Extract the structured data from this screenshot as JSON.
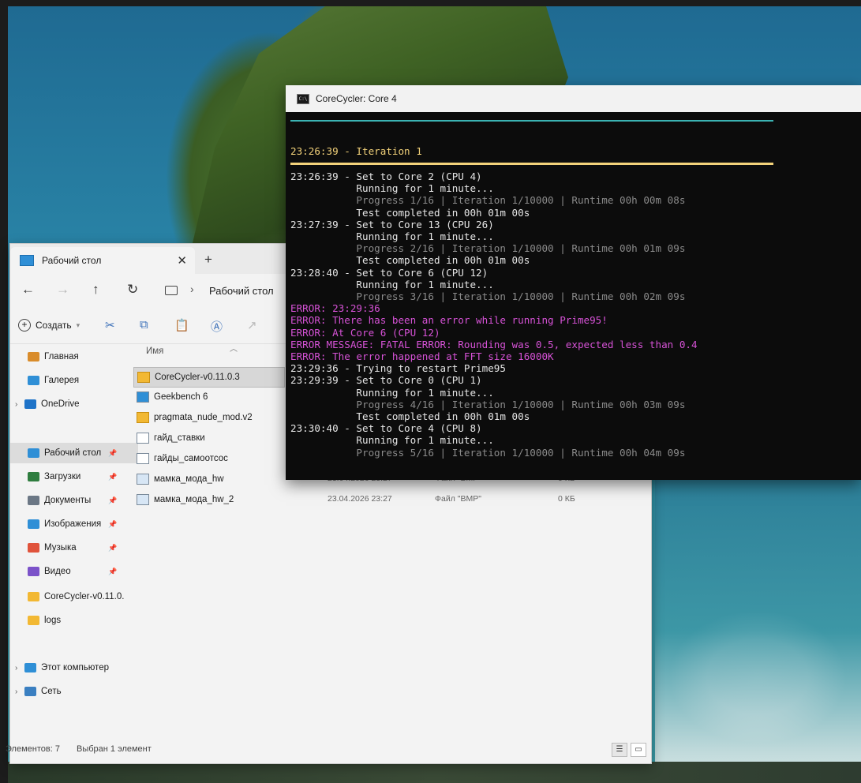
{
  "console": {
    "title": "CoreCycler: Core 4",
    "icon_glyph": "C:\\",
    "iteration_header": "23:26:39 - Iteration 1",
    "lines": [
      {
        "text": "23:26:39 - Set to Core 2 (CPU 4)",
        "style": "normal"
      },
      {
        "text": "           Running for 1 minute...",
        "style": "normal"
      },
      {
        "text": "           Progress 1/16 | Iteration 1/10000 | Runtime 00h 00m 08s",
        "style": "grey"
      },
      {
        "text": "           Test completed in 00h 01m 00s",
        "style": "normal"
      },
      {
        "text": "23:27:39 - Set to Core 13 (CPU 26)",
        "style": "normal"
      },
      {
        "text": "           Running for 1 minute...",
        "style": "normal"
      },
      {
        "text": "           Progress 2/16 | Iteration 1/10000 | Runtime 00h 01m 09s",
        "style": "grey"
      },
      {
        "text": "           Test completed in 00h 01m 00s",
        "style": "normal"
      },
      {
        "text": "23:28:40 - Set to Core 6 (CPU 12)",
        "style": "normal"
      },
      {
        "text": "           Running for 1 minute...",
        "style": "normal"
      },
      {
        "text": "           Progress 3/16 | Iteration 1/10000 | Runtime 00h 02m 09s",
        "style": "grey"
      },
      {
        "text": "ERROR: 23:29:36",
        "style": "magenta"
      },
      {
        "text": "ERROR: There has been an error while running Prime95!",
        "style": "magenta"
      },
      {
        "text": "ERROR: At Core 6 (CPU 12)",
        "style": "magenta"
      },
      {
        "text": "ERROR MESSAGE: FATAL ERROR: Rounding was 0.5, expected less than 0.4",
        "style": "magenta"
      },
      {
        "text": "ERROR: The error happened at FFT size 16000K",
        "style": "magenta"
      },
      {
        "text": "23:29:36 - Trying to restart Prime95",
        "style": "normal"
      },
      {
        "text": "23:29:39 - Set to Core 0 (CPU 1)",
        "style": "normal"
      },
      {
        "text": "           Running for 1 minute...",
        "style": "normal"
      },
      {
        "text": "           Progress 4/16 | Iteration 1/10000 | Runtime 00h 03m 09s",
        "style": "grey"
      },
      {
        "text": "           Test completed in 00h 01m 00s",
        "style": "normal"
      },
      {
        "text": "23:30:40 - Set to Core 4 (CPU 8)",
        "style": "normal"
      },
      {
        "text": "           Running for 1 minute...",
        "style": "normal"
      },
      {
        "text": "           Progress 5/16 | Iteration 1/10000 | Runtime 00h 04m 09s",
        "style": "grey"
      }
    ],
    "colors": {
      "header_rule": "#f3d27a",
      "top_rule": "#3bb3b3",
      "error": "#d652d6",
      "progress": "#8a8a8a"
    }
  },
  "explorer": {
    "tab_title": "Рабочий стол",
    "new_tab": "+",
    "close": "✕",
    "address": "Рабочий стол",
    "create_label": "Создать",
    "column_name": "Имя",
    "sidebar": [
      {
        "label": "Главная",
        "icon": "home-icon",
        "pinned": false
      },
      {
        "label": "Галерея",
        "icon": "gallery-icon",
        "pinned": false
      },
      {
        "label": "OneDrive",
        "icon": "cloud-icon",
        "pinned": false
      },
      {
        "label": "Рабочий стол",
        "icon": "desktop-icon",
        "pinned": true
      },
      {
        "label": "Загрузки",
        "icon": "download-icon",
        "pinned": true
      },
      {
        "label": "Документы",
        "icon": "documents-icon",
        "pinned": true
      },
      {
        "label": "Изображения",
        "icon": "images-icon",
        "pinned": true
      },
      {
        "label": "Музыка",
        "icon": "music-icon",
        "pinned": true
      },
      {
        "label": "Видео",
        "icon": "video-icon",
        "pinned": true
      },
      {
        "label": "CoreCycler-v0.11.0.",
        "icon": "folder-icon",
        "pinned": false
      },
      {
        "label": "logs",
        "icon": "folder-icon",
        "pinned": false
      },
      {
        "label": "Этот компьютер",
        "icon": "computer-icon",
        "pinned": false
      },
      {
        "label": "Сеть",
        "icon": "network-icon",
        "pinned": false
      }
    ],
    "files": [
      {
        "name": "CoreCycler-v0.11.0.3",
        "icon": "folder-icon",
        "date": "",
        "type": "",
        "size": ""
      },
      {
        "name": "Geekbench 6",
        "icon": "shortcut-icon",
        "date": "",
        "type": "",
        "size": ""
      },
      {
        "name": "pragmata_nude_mod.v2",
        "icon": "folder-icon",
        "date": "",
        "type": "",
        "size": ""
      },
      {
        "name": "гайд_ставки",
        "icon": "file-icon",
        "date": "",
        "type": "",
        "size": ""
      },
      {
        "name": "гайды_самоотсос",
        "icon": "file-icon",
        "date": "",
        "type": "",
        "size": ""
      },
      {
        "name": "мамка_мода_hw",
        "icon": "bmp-icon",
        "date": "23.04.2026 23:27",
        "type": "Файл \"BMP\"",
        "size": "0 КБ"
      },
      {
        "name": "мамка_мода_hw_2",
        "icon": "bmp-icon",
        "date": "23.04.2026 23:27",
        "type": "Файл \"BMP\"",
        "size": "0 КБ"
      }
    ],
    "status_count": "Элементов: 7",
    "status_selected": "Выбран 1 элемент",
    "colors": {
      "folder": "#f2b833",
      "accent": "#2f8fd6"
    }
  }
}
